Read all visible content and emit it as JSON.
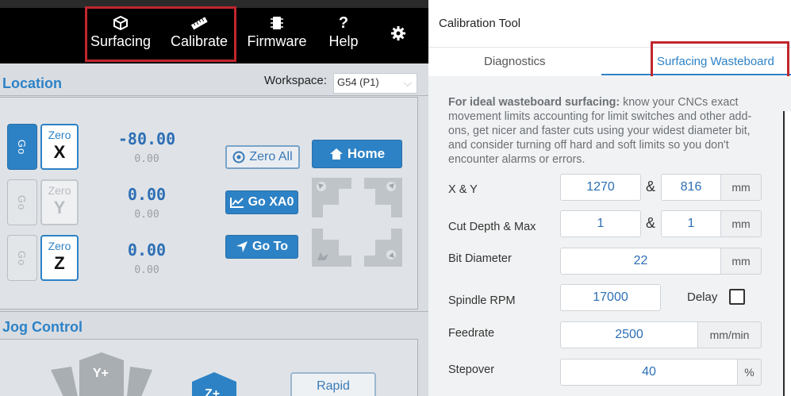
{
  "toolbar": {
    "items": [
      {
        "label": "Surfacing",
        "icon": "surfacing-icon"
      },
      {
        "label": "Calibrate",
        "icon": "ruler-icon"
      },
      {
        "label": "Firmware",
        "icon": "chip-icon"
      },
      {
        "label": "Help",
        "icon": "question-icon"
      },
      {
        "label": "",
        "icon": "gear-icon"
      }
    ]
  },
  "location": {
    "title": "Location",
    "workspace_label": "Workspace:",
    "workspace_value": "G54 (P1)",
    "axes": [
      {
        "go": "Go",
        "zero": "Zero",
        "axis": "X",
        "main": "-80.00",
        "sub": "0.00",
        "enabled": true
      },
      {
        "go": "Go",
        "zero": "Zero",
        "axis": "Y",
        "main": "0.00",
        "sub": "0.00",
        "enabled": false
      },
      {
        "go": "Go",
        "zero": "Zero",
        "axis": "Z",
        "main": "0.00",
        "sub": "0.00",
        "enabled": true
      }
    ],
    "zero_all": "Zero All",
    "go_xa0": "Go XA0",
    "go_to": "Go To",
    "home": "Home"
  },
  "jog": {
    "title": "Jog Control",
    "y_plus": "Y+",
    "z_plus": "Z+",
    "rapid": "Rapid"
  },
  "calibration": {
    "title": "Calibration Tool",
    "tabs": [
      "Diagnostics",
      "Surfacing Wasteboard"
    ],
    "info_bold": "For ideal wasteboard surfacing:",
    "info_text": " know your CNCs exact movement limits accounting for limit switches and other add-ons, get nicer and faster cuts using your widest diameter bit, and consider turning off hard and soft limits so you don't encounter alarms or errors.",
    "fields": {
      "xy_label": "X & Y",
      "x_value": "1270",
      "y_value": "816",
      "xy_unit": "mm",
      "amp": "&",
      "cut_label": "Cut Depth & Max",
      "cut_depth": "1",
      "cut_max": "1",
      "cut_unit": "mm",
      "bit_label": "Bit Diameter",
      "bit_value": "22",
      "bit_unit": "mm",
      "rpm_label": "Spindle RPM",
      "rpm_value": "17000",
      "delay_label": "Delay",
      "feed_label": "Feedrate",
      "feed_value": "2500",
      "feed_unit": "mm/min",
      "step_label": "Stepover",
      "step_value": "40",
      "step_unit": "%"
    }
  },
  "colors": {
    "accent": "#2d82c6",
    "highlight": "#c0262d",
    "toolbar": "#000000"
  }
}
